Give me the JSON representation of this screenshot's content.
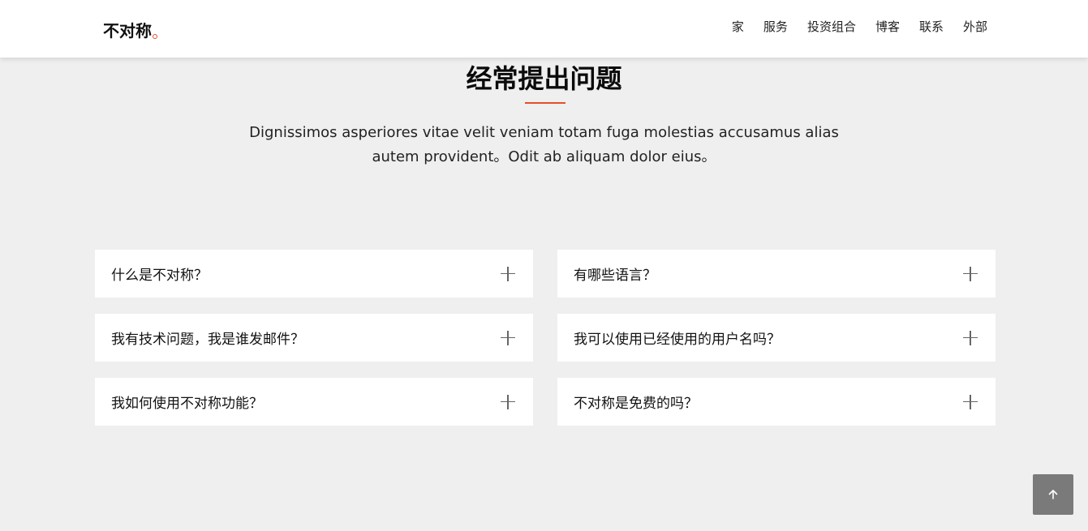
{
  "header": {
    "logo_text": "不对称",
    "nav": [
      "家",
      "服务",
      "投资组合",
      "博客",
      "联系",
      "外部"
    ]
  },
  "section": {
    "title": "经常提出问题",
    "description": "Dignissimos asperiores vitae velit veniam totam fuga molestias accusamus alias autem provident。Odit ab aliquam dolor eius。"
  },
  "faq": [
    {
      "question": "什么是不对称？"
    },
    {
      "question": "有哪些语言？"
    },
    {
      "question": "我有技术问题，我是谁发邮件？"
    },
    {
      "question": "我可以使用已经使用的用户名吗？"
    },
    {
      "question": "我如何使用不对称功能？"
    },
    {
      "question": "不对称是免费的吗？"
    }
  ],
  "colors": {
    "accent": "#e74c2a",
    "background": "#efefef",
    "back_to_top": "#7a7a7a"
  },
  "icons": {
    "faq_toggle": "plus-icon",
    "back_to_top": "arrow-up-icon"
  }
}
